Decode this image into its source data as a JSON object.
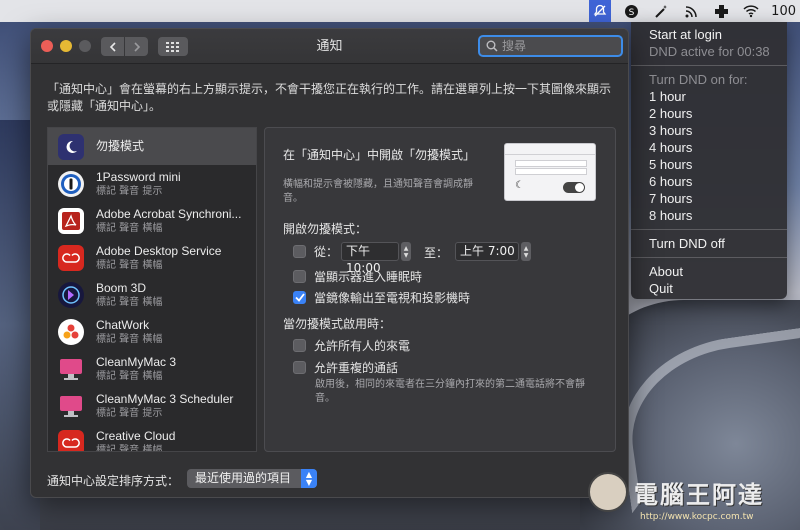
{
  "menubar": {
    "icons": [
      "dnd-bell-icon",
      "s-circle-icon",
      "magic-wand-icon",
      "rss-icon",
      "medical-cross-icon",
      "wifi-icon"
    ],
    "battery_text": "100"
  },
  "dnd_menu": {
    "start_at_login": "Start at login",
    "dnd_status": "DND active for 00:38",
    "turn_on_header": "Turn DND on for:",
    "durations": [
      "1 hour",
      "2 hours",
      "3 hours",
      "4 hours",
      "5 hours",
      "6 hours",
      "7 hours",
      "8 hours"
    ],
    "turn_off": "Turn DND off",
    "about": "About",
    "quit": "Quit"
  },
  "window": {
    "title": "通知",
    "search_placeholder": "搜尋",
    "description": "「通知中心」會在螢幕的右上方顯示提示，不會干擾您正在執行的工作。請在選單列上按一下其圖像來顯示或隱藏「通知中心」。"
  },
  "app_list": [
    {
      "name": "勿擾模式",
      "sub": "",
      "icon": "moon-icon",
      "color": "#3b3b8f"
    },
    {
      "name": "1Password mini",
      "sub": "標記 聲音 提示",
      "icon": "1password-icon",
      "color": "#2f6bd1"
    },
    {
      "name": "Adobe Acrobat Synchroni...",
      "sub": "標記 聲音 橫幅",
      "icon": "acrobat-icon",
      "color": "#b8241d"
    },
    {
      "name": "Adobe Desktop Service",
      "sub": "標記 聲音 橫幅",
      "icon": "creative-cloud-icon",
      "color": "#d7281f"
    },
    {
      "name": "Boom 3D",
      "sub": "標記 聲音 橫幅",
      "icon": "boom3d-icon",
      "color": "#2a2a5a"
    },
    {
      "name": "ChatWork",
      "sub": "標記 聲音 橫幅",
      "icon": "chatwork-icon",
      "color": "#ffffff"
    },
    {
      "name": "CleanMyMac 3",
      "sub": "標記 聲音 橫幅",
      "icon": "cleanmymac-icon",
      "color": "#e04a8a"
    },
    {
      "name": "CleanMyMac 3 Scheduler",
      "sub": "標記 聲音 提示",
      "icon": "cleanmymac-scheduler-icon",
      "color": "#e04a8a"
    },
    {
      "name": "Creative Cloud",
      "sub": "標記 聲音 橫幅",
      "icon": "creative-cloud-icon",
      "color": "#d7281f"
    }
  ],
  "dnd_panel": {
    "title": "在「通知中心」中開啟「勿擾模式」",
    "subtitle": "橫幅和提示會被隱藏，且通知聲音會調成靜音。",
    "enable_header": "開啟勿擾模式：",
    "from_label": "從：",
    "from_time": "下午10:00",
    "to_label": "至：",
    "to_time": "上午  7:00",
    "from_checked": false,
    "display_sleep_label": "當顯示器進入睡眠時",
    "display_sleep_checked": false,
    "mirroring_label": "當鏡像輸出至電視和投影機時",
    "mirroring_checked": true,
    "when_on_header": "當勿擾模式啟用時：",
    "allow_calls_label": "允許所有人的來電",
    "allow_calls_checked": false,
    "allow_repeat_label": "允許重複的通話",
    "allow_repeat_checked": false,
    "repeat_hint": "啟用後，相同的來電者在三分鐘內打來的第二通電話將不會靜音。"
  },
  "sort": {
    "label": "通知中心設定排序方式：",
    "value": "最近使用過的項目"
  },
  "watermark": {
    "text": "電腦王阿達",
    "url": "http://www.kocpc.com.tw"
  }
}
